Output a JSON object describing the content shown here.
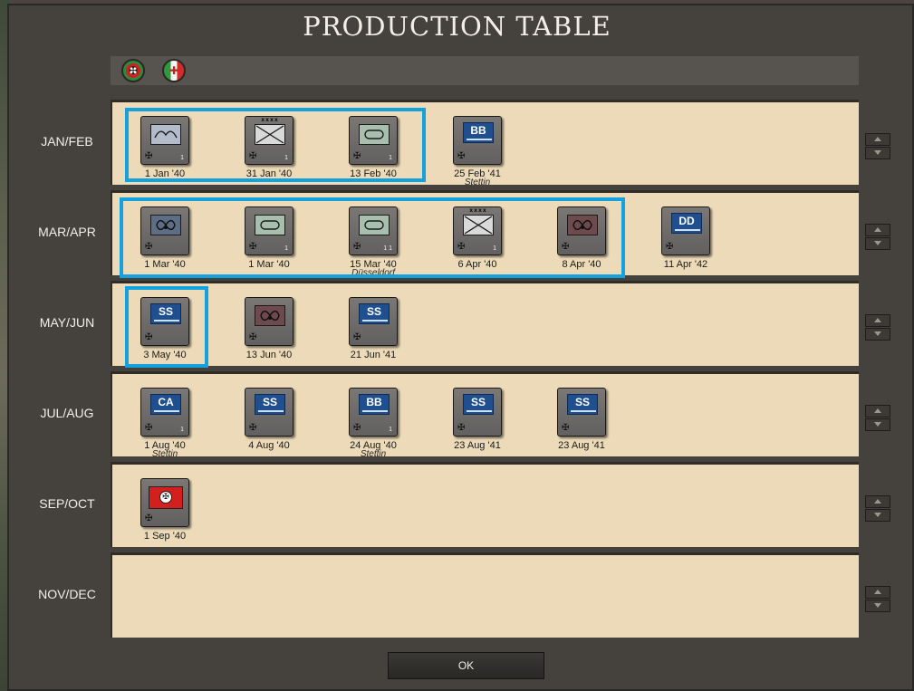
{
  "title": "PRODUCTION TABLE",
  "nations": [
    {
      "icon": "target-flag-icon",
      "glyph": "✠"
    },
    {
      "icon": "italy-flag-icon",
      "glyph": "✚"
    }
  ],
  "ok_label": "OK",
  "highlight_color": "#12a2e0",
  "rows": [
    {
      "label": "JAN/FEB",
      "units": [
        {
          "kind": "inf",
          "date": "1 Jan '40",
          "cross": "✠",
          "num": "1"
        },
        {
          "kind": "hq",
          "date": "31 Jan '40",
          "cross": "✠",
          "num": "1",
          "mark": "xxxx"
        },
        {
          "kind": "arm",
          "date": "13 Feb '40",
          "cross": "✠",
          "num": "1"
        },
        {
          "kind": "ship",
          "code": "BB",
          "date": "25 Feb '41",
          "place": "Stettin",
          "cross": "✠"
        }
      ]
    },
    {
      "label": "MAR/APR",
      "units": [
        {
          "kind": "sub",
          "date": "1 Mar '40",
          "cross": "✠"
        },
        {
          "kind": "arm",
          "date": "1 Mar '40",
          "cross": "✠",
          "num": "1"
        },
        {
          "kind": "arm",
          "date": "15 Mar '40",
          "place": "Düsseldorf",
          "cross": "✠",
          "num": "1 1"
        },
        {
          "kind": "hq",
          "date": "6 Apr '40",
          "cross": "✠",
          "num": "1",
          "mark": "xxxx"
        },
        {
          "kind": "subr",
          "date": "8 Apr '40",
          "cross": "✠"
        },
        {
          "kind": "ship",
          "code": "DD",
          "date": "11 Apr '42",
          "cross": "✠"
        }
      ]
    },
    {
      "label": "MAY/JUN",
      "units": [
        {
          "kind": "ship",
          "code": "SS",
          "date": "3 May '40",
          "cross": "✠"
        },
        {
          "kind": "subr",
          "date": "13 Jun '40",
          "cross": "✠"
        },
        {
          "kind": "ship",
          "code": "SS",
          "date": "21 Jun '41",
          "cross": "✠"
        }
      ]
    },
    {
      "label": "JUL/AUG",
      "units": [
        {
          "kind": "ship",
          "code": "CA",
          "date": "1 Aug '40",
          "place": "Stettin",
          "cross": "✠",
          "num": "1"
        },
        {
          "kind": "ship",
          "code": "SS",
          "date": "4 Aug '40",
          "cross": "✠"
        },
        {
          "kind": "ship",
          "code": "BB",
          "date": "24 Aug '40",
          "place": "Stettin",
          "cross": "✠",
          "num": "1"
        },
        {
          "kind": "ship",
          "code": "SS",
          "date": "23 Aug '41",
          "cross": "✠"
        },
        {
          "kind": "ship",
          "code": "SS",
          "date": "23 Aug '41",
          "cross": "✠"
        }
      ]
    },
    {
      "label": "SEP/OCT",
      "units": [
        {
          "kind": "flag",
          "date": "1 Sep '40",
          "cross": "✠",
          "glyph": "✠"
        }
      ]
    },
    {
      "label": "NOV/DEC",
      "units": []
    }
  ]
}
